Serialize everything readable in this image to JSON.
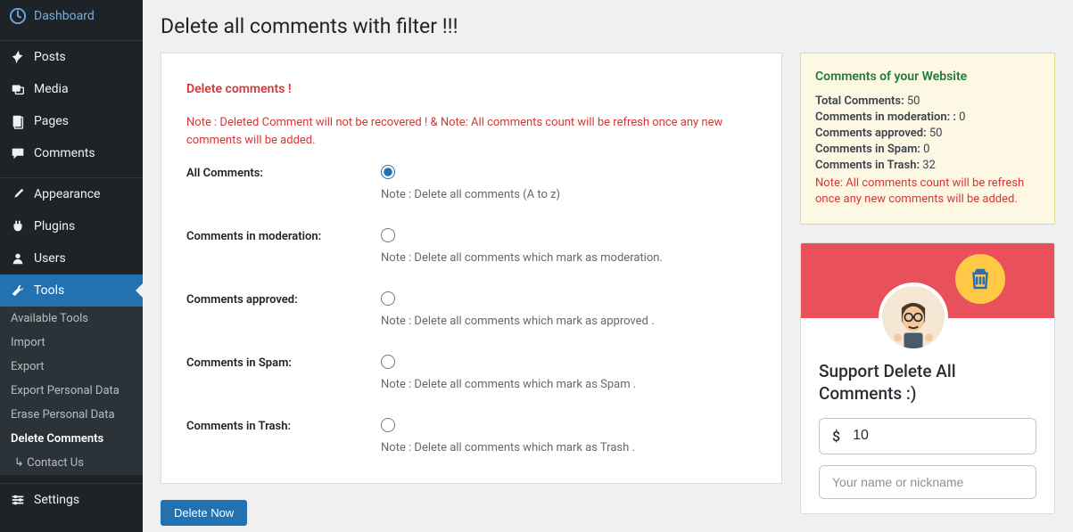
{
  "sidebar": {
    "items": [
      {
        "label": "Dashboard"
      },
      {
        "label": "Posts"
      },
      {
        "label": "Media"
      },
      {
        "label": "Pages"
      },
      {
        "label": "Comments"
      },
      {
        "label": "Appearance"
      },
      {
        "label": "Plugins"
      },
      {
        "label": "Users"
      },
      {
        "label": "Tools"
      },
      {
        "label": "Settings"
      }
    ],
    "submenu": [
      {
        "label": "Available Tools"
      },
      {
        "label": "Import"
      },
      {
        "label": "Export"
      },
      {
        "label": "Export Personal Data"
      },
      {
        "label": "Erase Personal Data"
      },
      {
        "label": "Delete Comments",
        "current": true
      },
      {
        "label": "Contact Us",
        "contact": true
      }
    ]
  },
  "page": {
    "title": "Delete all comments with filter !!!"
  },
  "form": {
    "heading": "Delete comments !",
    "note": "Note : Deleted Comment will not be recovered ! & Note: All comments count will be refresh once any new comments will be added.",
    "options": {
      "all": {
        "label": "All Comments:",
        "note": "Note : Delete all comments (A to z)"
      },
      "mod": {
        "label": "Comments in moderation:",
        "note": "Note : Delete all comments which mark as moderation."
      },
      "approved": {
        "label": "Comments approved:",
        "note": "Note : Delete all comments which mark as approved ."
      },
      "spam": {
        "label": "Comments in Spam:",
        "note": "Note : Delete all comments which mark as Spam ."
      },
      "trash": {
        "label": "Comments in Trash:",
        "note": "Note : Delete all comments which mark as Trash ."
      }
    },
    "button": "Delete Now"
  },
  "stats": {
    "heading": "Comments of your Website",
    "total_label": "Total Comments:",
    "total": "50",
    "mod_label": "Comments in moderation: :",
    "mod": "0",
    "approved_label": "Comments approved:",
    "approved": "50",
    "spam_label": "Comments in Spam:",
    "spam": "0",
    "trash_label": "Comments in Trash:",
    "trash": "32",
    "warn": "Note: All comments count will be refresh once any new comments will be added."
  },
  "support": {
    "heading": "Support Delete All Comments :)",
    "currency": "$",
    "amount": "10",
    "name_placeholder": "Your name or nickname"
  }
}
